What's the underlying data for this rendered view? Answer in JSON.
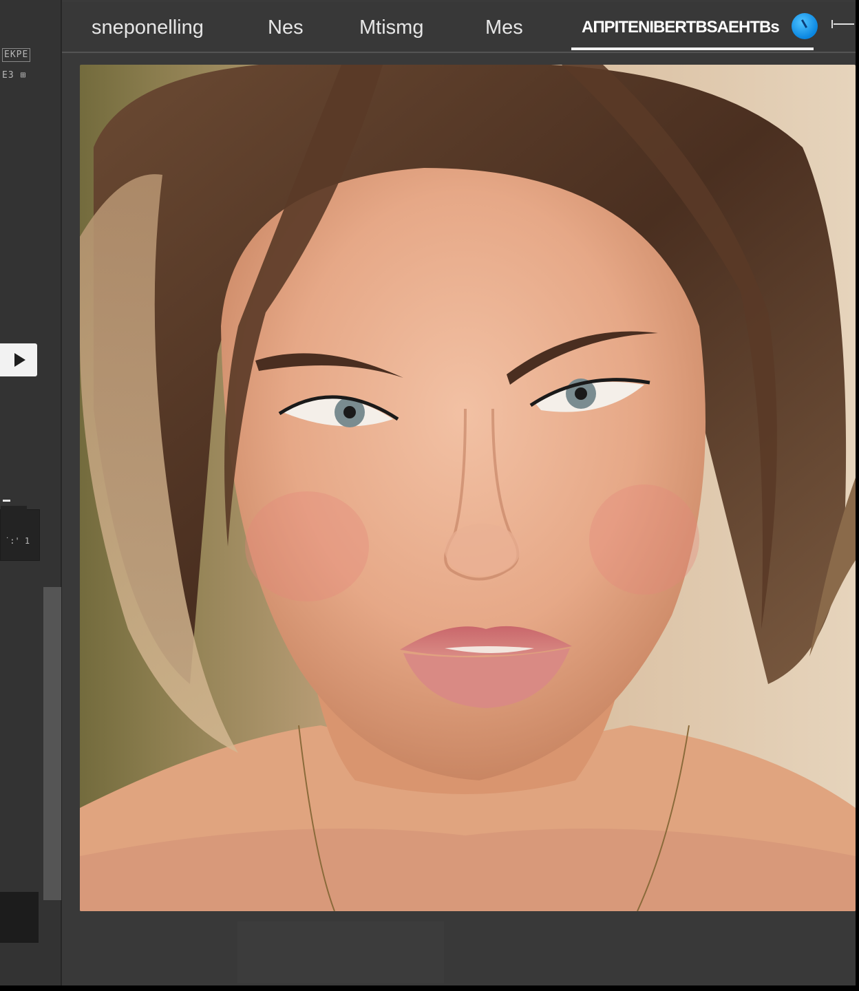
{
  "left_panel": {
    "label_top": "EKPE",
    "label_second": "E3 ⊞",
    "field_value": "˙:' 1",
    "play_icon": "play-icon"
  },
  "tabs": [
    {
      "label": "sneponelling"
    },
    {
      "label": "Nes"
    },
    {
      "label": "Mtismg"
    },
    {
      "label": "Mes"
    },
    {
      "label": "ΑΠPITENIBERTBSAEHTBs",
      "active": true
    }
  ],
  "tab_icons": {
    "active_tab_icon": "compass-icon",
    "overflow_icon": "slider-icon"
  },
  "canvas": {
    "image_subject": "portrait-photo"
  },
  "colors": {
    "panel_bg": "#333333",
    "tab_bar_bg": "#383838",
    "accent_blue": "#1a9bf0",
    "active_underline": "#f2f2f2"
  }
}
